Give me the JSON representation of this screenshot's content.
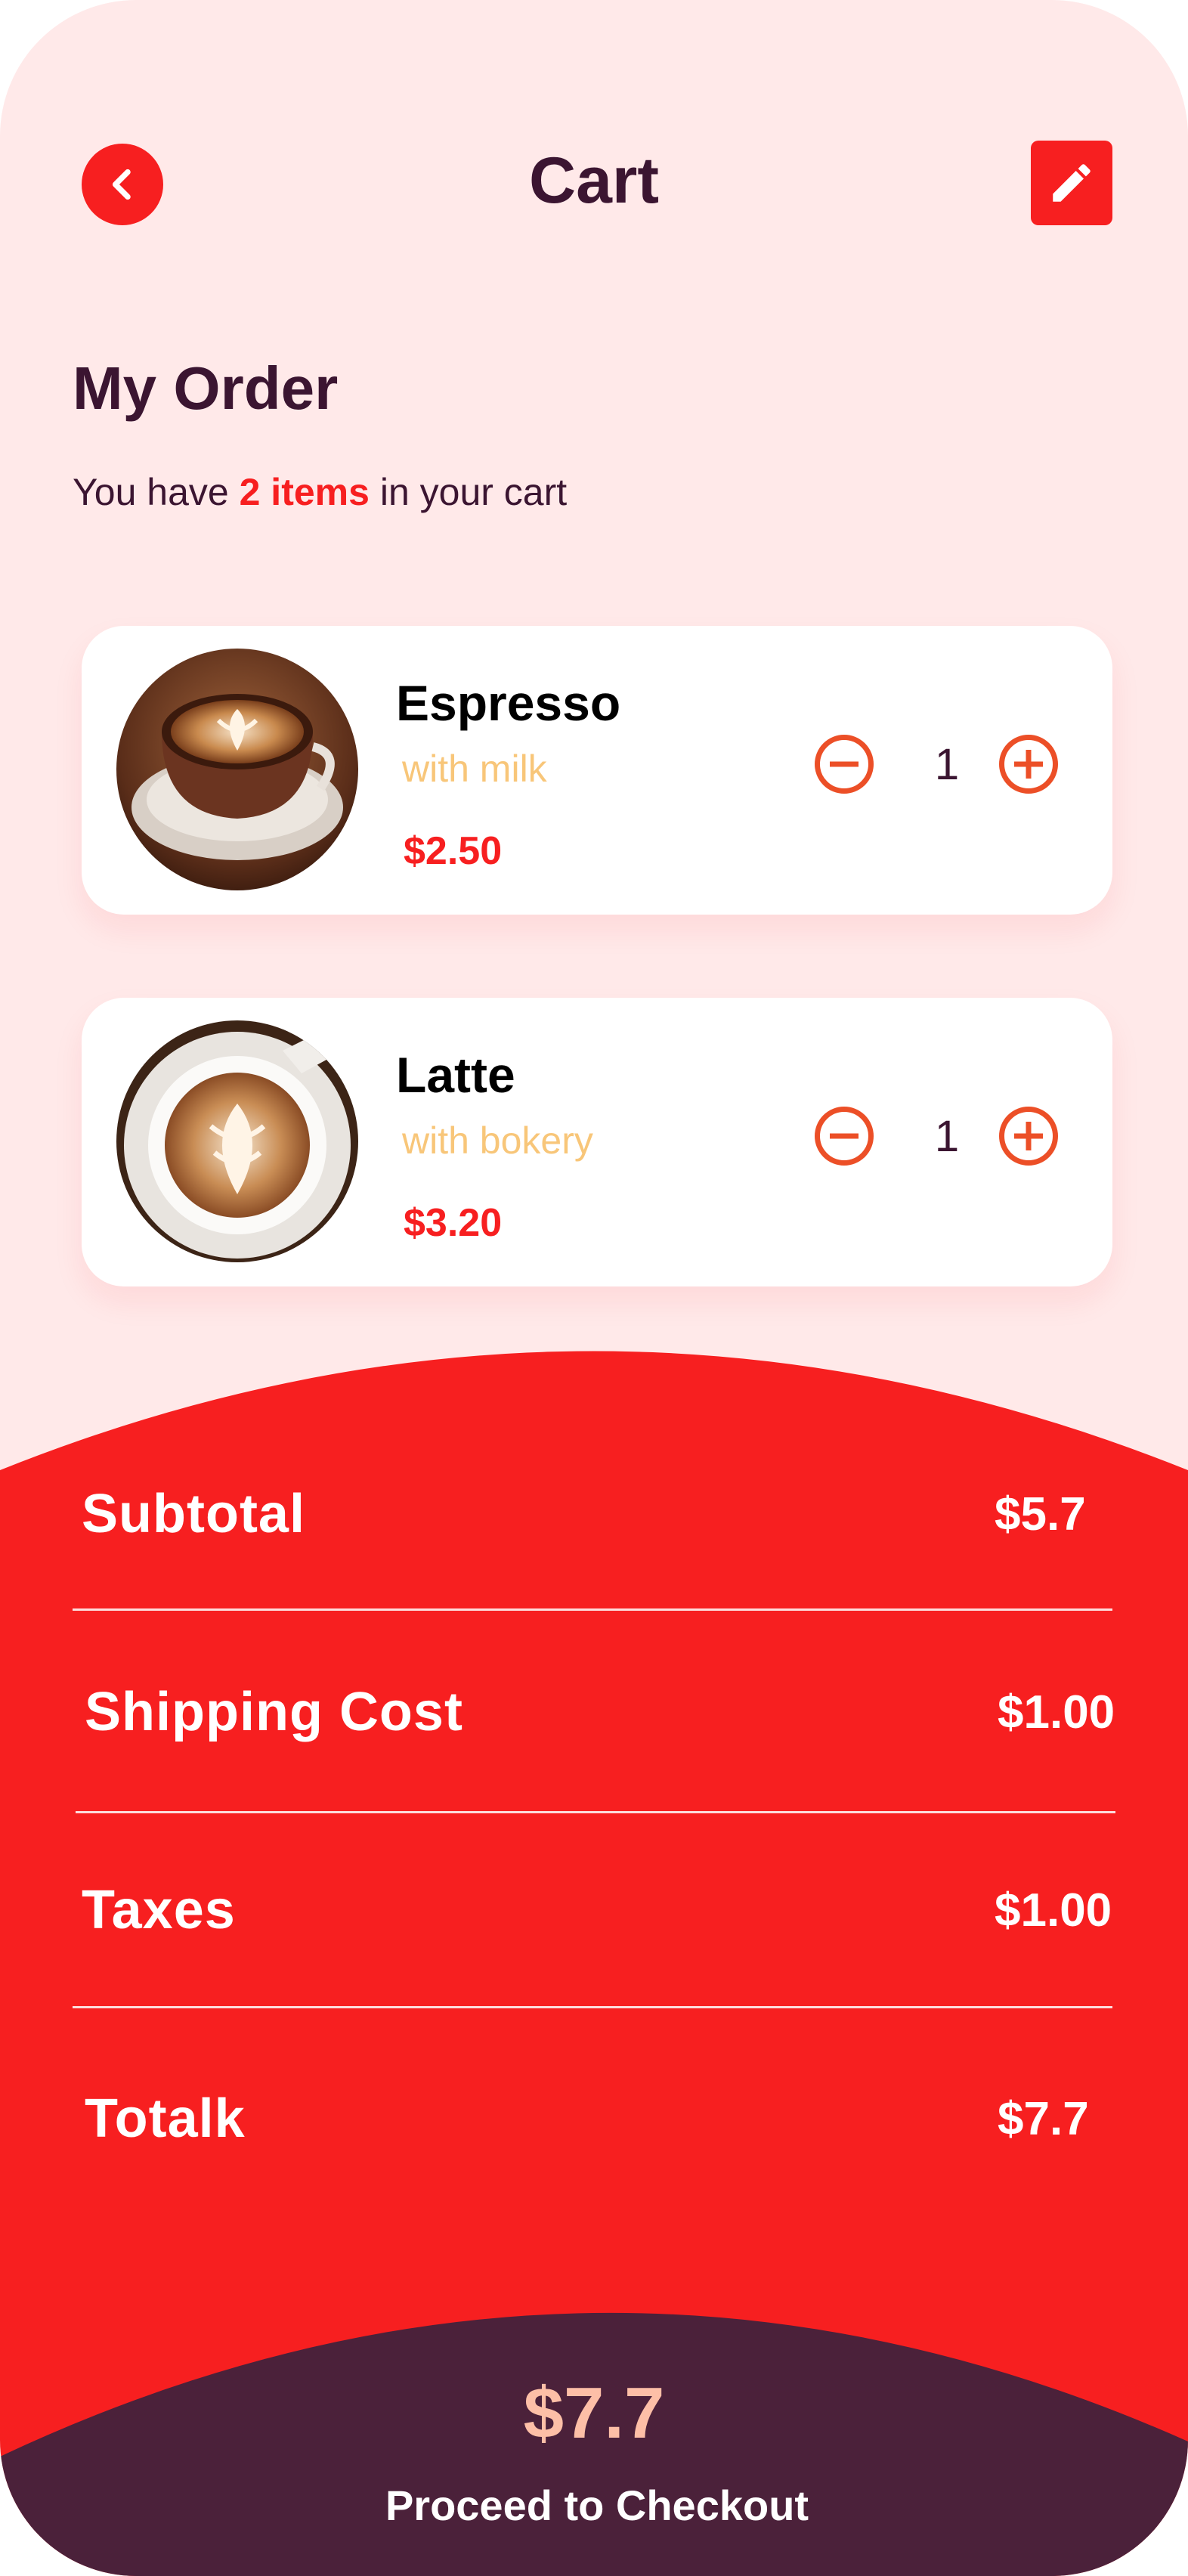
{
  "header": {
    "title": "Cart",
    "back_icon": "chevron-left-icon",
    "edit_icon": "pencil-icon"
  },
  "order": {
    "title": "My Order",
    "summary_prefix": "You have",
    "summary_count": "2 items",
    "summary_suffix": "in your cart"
  },
  "items": [
    {
      "name": "Espresso",
      "subtitle": "with milk",
      "price": "$2.50",
      "quantity": "1"
    },
    {
      "name": "Latte",
      "subtitle": "with bokery",
      "price": "$3.20",
      "quantity": "1"
    }
  ],
  "summary": {
    "subtotal_label": "Subtotal",
    "subtotal_value": "$5.7",
    "shipping_label": "Shipping Cost",
    "shipping_value": "$1.00",
    "taxes_label": "Taxes",
    "taxes_value": "$1.00",
    "total_label": "Totalk",
    "total_value": "$7.7"
  },
  "checkout": {
    "total": "$7.7",
    "button_label": "Proceed to Checkout"
  },
  "colors": {
    "background": "#ffe9e9",
    "accent": "#f71f20",
    "dark": "#3b1531",
    "checkout_bg": "#4b213a",
    "subtitle": "#f8c679",
    "qty": "#ec4f27"
  }
}
